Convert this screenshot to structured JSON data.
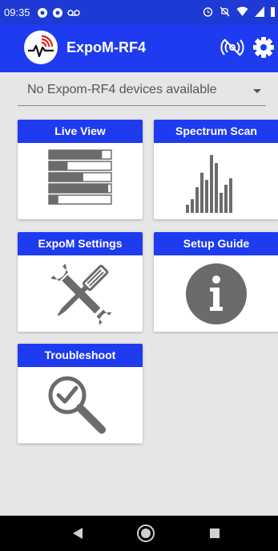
{
  "status_bar": {
    "time": "09:35",
    "icons_left": [
      "message-icon",
      "message-icon",
      "voicemail-icon"
    ],
    "icons_right": [
      "alarm-icon",
      "do-not-disturb-icon",
      "wifi-icon",
      "signal-icon",
      "battery-icon"
    ]
  },
  "app_bar": {
    "title": "ExpoM-RF4",
    "logo": "expom-logo",
    "actions": [
      "bluetooth-off-icon",
      "gear-icon"
    ],
    "color": "#1e3bf0"
  },
  "device_select": {
    "selected": "No Expom-RF4 devices available"
  },
  "tiles": {
    "live_view": {
      "label": "Live View",
      "icon": "bars-list-icon",
      "bar_levels": [
        0.85,
        0.3,
        0.55,
        0.95,
        0.15
      ]
    },
    "spectrum_scan": {
      "label": "Spectrum Scan",
      "icon": "spectrum-bars-icon"
    },
    "expom_settings": {
      "label": "ExpoM Settings",
      "icon": "wrench-screwdriver-icon"
    },
    "setup_guide": {
      "label": "Setup Guide",
      "icon": "info-icon"
    },
    "troubleshoot": {
      "label": "Troubleshoot",
      "icon": "magnifier-check-icon"
    }
  },
  "nav": [
    "back-icon",
    "home-icon",
    "recents-icon"
  ],
  "colors": {
    "header_blue": "#1e3bf0",
    "status_blue": "#1d3ad4",
    "icon_gray": "#6b6b6b",
    "background": "#e6e6e6"
  }
}
